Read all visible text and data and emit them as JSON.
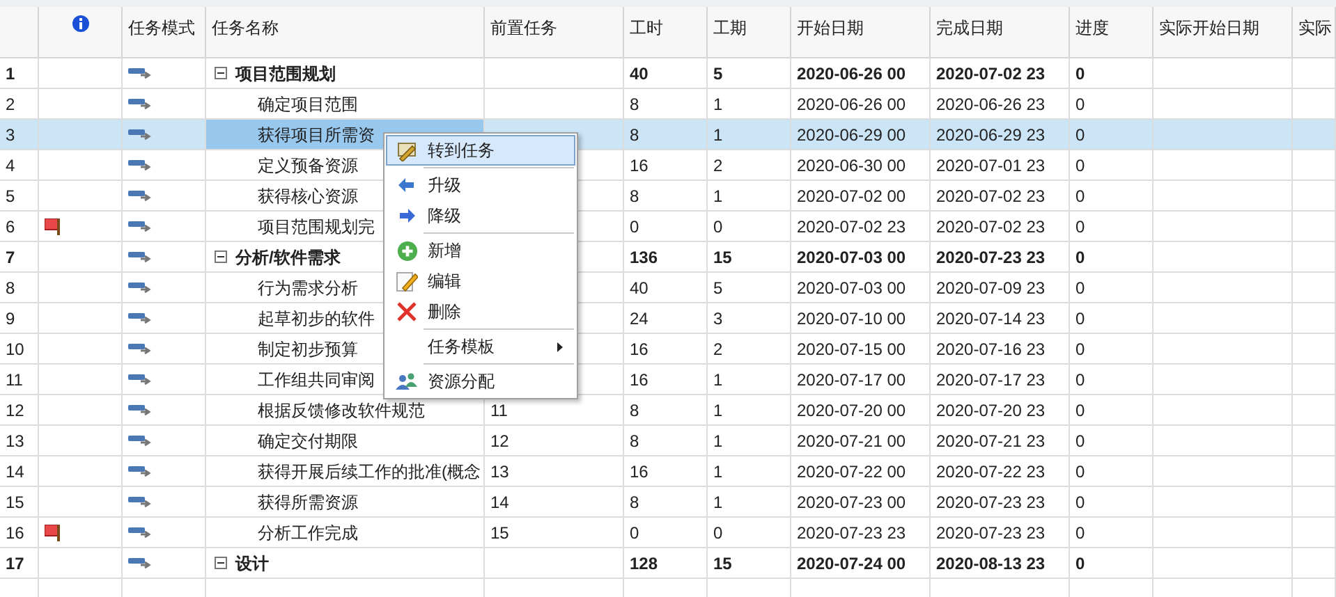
{
  "table": {
    "columns": [
      "任务模式",
      "任务名称",
      "前置任务",
      "工时",
      "工期",
      "开始日期",
      "完成日期",
      "进度",
      "实际开始日期",
      "实际"
    ],
    "rows": [
      {
        "id": "1",
        "kind": "summary",
        "expanded": true,
        "flag": false,
        "selected": false,
        "name": "项目范围规划",
        "pred": "",
        "work": "40",
        "duration": "5",
        "start": "2020-06-26 00",
        "finish": "2020-07-02 23",
        "progress": "0"
      },
      {
        "id": "2",
        "kind": "task",
        "flag": false,
        "selected": false,
        "name": "确定项目范围",
        "pred": "",
        "work": "8",
        "duration": "1",
        "start": "2020-06-26 00",
        "finish": "2020-06-26 23",
        "progress": "0"
      },
      {
        "id": "3",
        "kind": "task",
        "flag": false,
        "selected": true,
        "name": "获得项目所需资",
        "pred": "",
        "work": "8",
        "duration": "1",
        "start": "2020-06-29 00",
        "finish": "2020-06-29 23",
        "progress": "0"
      },
      {
        "id": "4",
        "kind": "task",
        "flag": false,
        "selected": false,
        "name": "定义预备资源",
        "pred": "",
        "work": "16",
        "duration": "2",
        "start": "2020-06-30 00",
        "finish": "2020-07-01 23",
        "progress": "0"
      },
      {
        "id": "5",
        "kind": "task",
        "flag": false,
        "selected": false,
        "name": "获得核心资源",
        "pred": "",
        "work": "8",
        "duration": "1",
        "start": "2020-07-02 00",
        "finish": "2020-07-02 23",
        "progress": "0"
      },
      {
        "id": "6",
        "kind": "task",
        "flag": true,
        "selected": false,
        "name": "项目范围规划完",
        "pred": "",
        "work": "0",
        "duration": "0",
        "start": "2020-07-02 23",
        "finish": "2020-07-02 23",
        "progress": "0"
      },
      {
        "id": "7",
        "kind": "summary",
        "expanded": true,
        "flag": false,
        "selected": false,
        "name": "分析/软件需求",
        "pred": "",
        "work": "136",
        "duration": "15",
        "start": "2020-07-03 00",
        "finish": "2020-07-23 23",
        "progress": "0"
      },
      {
        "id": "8",
        "kind": "task",
        "flag": false,
        "selected": false,
        "name": "行为需求分析",
        "pred": "",
        "work": "40",
        "duration": "5",
        "start": "2020-07-03 00",
        "finish": "2020-07-09 23",
        "progress": "0"
      },
      {
        "id": "9",
        "kind": "task",
        "flag": false,
        "selected": false,
        "name": "起草初步的软件",
        "pred": "",
        "work": "24",
        "duration": "3",
        "start": "2020-07-10 00",
        "finish": "2020-07-14 23",
        "progress": "0"
      },
      {
        "id": "10",
        "kind": "task",
        "flag": false,
        "selected": false,
        "name": "制定初步预算",
        "pred": "",
        "work": "16",
        "duration": "2",
        "start": "2020-07-15 00",
        "finish": "2020-07-16 23",
        "progress": "0"
      },
      {
        "id": "11",
        "kind": "task",
        "flag": false,
        "selected": false,
        "name": "工作组共同审阅",
        "pred": "",
        "work": "16",
        "duration": "1",
        "start": "2020-07-17 00",
        "finish": "2020-07-17 23",
        "progress": "0"
      },
      {
        "id": "12",
        "kind": "task",
        "flag": false,
        "selected": false,
        "name": "根据反馈修改软件规范",
        "pred": "11",
        "work": "8",
        "duration": "1",
        "start": "2020-07-20 00",
        "finish": "2020-07-20 23",
        "progress": "0"
      },
      {
        "id": "13",
        "kind": "task",
        "flag": false,
        "selected": false,
        "name": "确定交付期限",
        "pred": "12",
        "work": "8",
        "duration": "1",
        "start": "2020-07-21 00",
        "finish": "2020-07-21 23",
        "progress": "0"
      },
      {
        "id": "14",
        "kind": "task",
        "flag": false,
        "selected": false,
        "name": "获得开展后续工作的批准(概念",
        "pred": "13",
        "work": "16",
        "duration": "1",
        "start": "2020-07-22 00",
        "finish": "2020-07-22 23",
        "progress": "0"
      },
      {
        "id": "15",
        "kind": "task",
        "flag": false,
        "selected": false,
        "name": "获得所需资源",
        "pred": "14",
        "work": "8",
        "duration": "1",
        "start": "2020-07-23 00",
        "finish": "2020-07-23 23",
        "progress": "0"
      },
      {
        "id": "16",
        "kind": "task",
        "flag": true,
        "selected": false,
        "name": "分析工作完成",
        "pred": "15",
        "work": "0",
        "duration": "0",
        "start": "2020-07-23 23",
        "finish": "2020-07-23 23",
        "progress": "0"
      },
      {
        "id": "17",
        "kind": "summary",
        "expanded": true,
        "flag": false,
        "selected": false,
        "name": "设计",
        "pred": "",
        "work": "128",
        "duration": "15",
        "start": "2020-07-24 00",
        "finish": "2020-08-13 23",
        "progress": "0"
      }
    ]
  },
  "context_menu": {
    "groups": [
      [
        {
          "label": "转到任务",
          "selected": true,
          "submenu": false
        }
      ],
      [
        {
          "label": "升级",
          "selected": false,
          "submenu": false
        },
        {
          "label": "降级",
          "selected": false,
          "submenu": false
        }
      ],
      [
        {
          "label": "新增",
          "selected": false,
          "submenu": false
        },
        {
          "label": "编辑",
          "selected": false,
          "submenu": false
        },
        {
          "label": "删除",
          "selected": false,
          "submenu": false
        }
      ],
      [
        {
          "label": "任务模板",
          "selected": false,
          "submenu": true
        }
      ],
      [
        {
          "label": "资源分配",
          "selected": false,
          "submenu": false
        }
      ]
    ]
  }
}
